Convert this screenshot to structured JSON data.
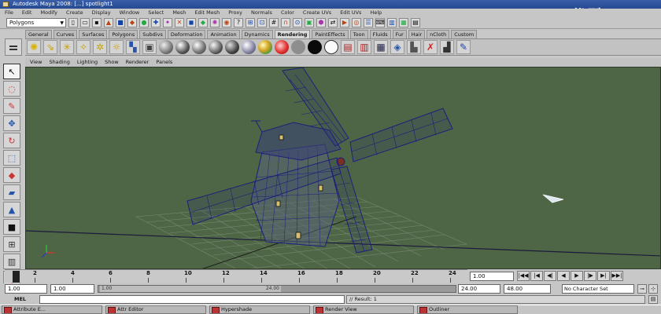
{
  "app": {
    "title": "Autodesk Maya 2008: [...] spotlight1",
    "watermark": "优酷网"
  },
  "menubar": [
    "File",
    "Edit",
    "Modify",
    "Create",
    "Display",
    "Window",
    "Select",
    "Mesh",
    "Edit Mesh",
    "Proxy",
    "Normals",
    "Color",
    "Create UVs",
    "Edit UVs",
    "Help"
  ],
  "statusline": {
    "menu_set": "Polygons"
  },
  "shelf": {
    "tabs": [
      "General",
      "Curves",
      "Surfaces",
      "Polygons",
      "Subdivs",
      "Deformation",
      "Animation",
      "Dynamics",
      "Rendering",
      "PaintEffects",
      "Toon",
      "Fluids",
      "Fur",
      "Hair",
      "nCloth",
      "Custom"
    ],
    "active_tab": "Rendering"
  },
  "panel_menu": [
    "View",
    "Shading",
    "Lighting",
    "Show",
    "Renderer",
    "Panels"
  ],
  "timeslider": {
    "ticks": [
      "2",
      "4",
      "6",
      "8",
      "10",
      "12",
      "14",
      "16",
      "18",
      "20",
      "22",
      "24"
    ],
    "current_frame": "1.00"
  },
  "range": {
    "start": "1.00",
    "playback_start": "1.00",
    "slider_left": "1.00",
    "slider_right": "24.00",
    "playback_end": "24.00",
    "end": "48.00",
    "character_set": "No Character Set"
  },
  "command": {
    "label": "MEL",
    "result": "// Result: 1"
  },
  "taskbar": [
    "Attribute E...",
    "Attr Editor",
    "Hypershade",
    "Render View",
    "Outliner"
  ]
}
